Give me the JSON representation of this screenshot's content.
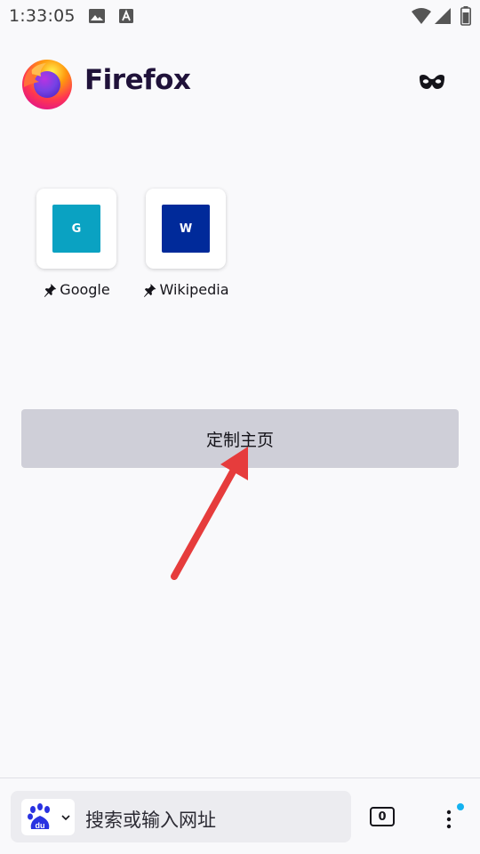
{
  "status_bar": {
    "time": "1:33:05"
  },
  "header": {
    "brand_name": "Firefox"
  },
  "shortcuts": [
    {
      "label": "Google",
      "tile_letter": "G",
      "tile_color": "#0aa2c2",
      "pinned": true
    },
    {
      "label": "Wikipedia",
      "tile_letter": "W",
      "tile_color": "#002a9a",
      "pinned": true
    }
  ],
  "customize_button": {
    "label": "定制主页"
  },
  "toolbar": {
    "search_placeholder": "搜索或输入网址",
    "search_engine_icon": "baidu-icon",
    "tab_count": "0",
    "menu_indicator_color": "#14b2f0"
  },
  "colors": {
    "background": "#f9f9fb",
    "button_bg": "#cfcfd8",
    "annotation_arrow": "#e63c3c"
  }
}
